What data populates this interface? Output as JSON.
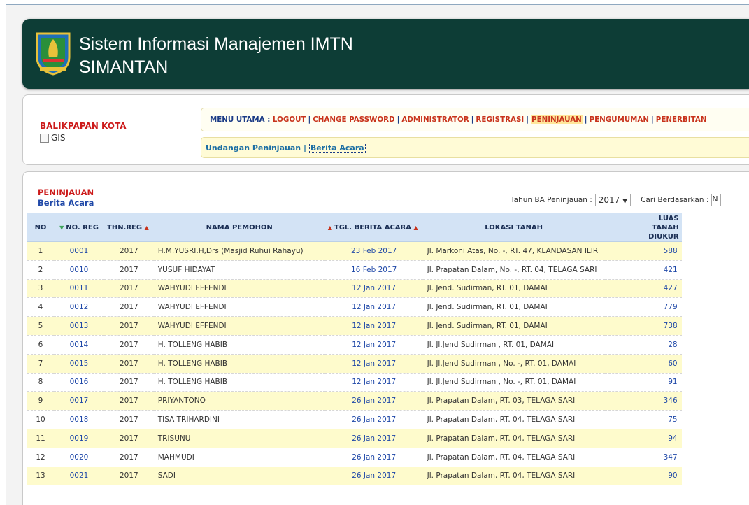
{
  "header": {
    "title": "Sistem Informasi Manajemen IMTN",
    "subtitle": "SIMANTAN"
  },
  "sidebar": {
    "city": "BALIKPAPAN KOTA",
    "gis_label": "GIS"
  },
  "menu": {
    "label": "MENU UTAMA :",
    "items": [
      "LOGOUT",
      "CHANGE PASSWORD",
      "ADMINISTRATOR",
      "REGISTRASI",
      "PENINJAUAN",
      "PENGUMUMAN",
      "PENERBITAN"
    ],
    "active": "PENINJAUAN"
  },
  "submenu": {
    "items": [
      "Undangan Peninjauan",
      "Berita Acara"
    ]
  },
  "section": {
    "title": "PENINJAUAN",
    "subtitle": "Berita Acara"
  },
  "filter": {
    "year_label": "Tahun BA Peninjauan :",
    "year_value": "2017",
    "search_label": "Cari Berdasarkan :",
    "search_value": "N"
  },
  "table": {
    "headers": [
      "NO",
      "NO. REG",
      "THN.REG",
      "NAMA PEMOHON",
      "TGL. BERITA ACARA",
      "LOKASI TANAH",
      "LUAS TANAH DIUKUR"
    ],
    "rows": [
      {
        "no": "1",
        "reg": "0001",
        "thn": "2017",
        "nama": "H.M.YUSRI.H,Drs (Masjid Ruhui Rahayu)",
        "tgl": "23 Feb 2017",
        "lokasi": "Jl. Markoni Atas, No. -, RT. 47, KLANDASAN ILIR",
        "luas": "588"
      },
      {
        "no": "2",
        "reg": "0010",
        "thn": "2017",
        "nama": "YUSUF HIDAYAT",
        "tgl": "16 Feb 2017",
        "lokasi": "Jl. Prapatan Dalam, No. -, RT. 04, TELAGA SARI",
        "luas": "421"
      },
      {
        "no": "3",
        "reg": "0011",
        "thn": "2017",
        "nama": "WAHYUDI EFFENDI",
        "tgl": "12 Jan 2017",
        "lokasi": "Jl. Jend. Sudirman, RT. 01, DAMAI",
        "luas": "427"
      },
      {
        "no": "4",
        "reg": "0012",
        "thn": "2017",
        "nama": "WAHYUDI EFFENDI",
        "tgl": "12 Jan 2017",
        "lokasi": "Jl. Jend. Sudirman, RT. 01, DAMAI",
        "luas": "779"
      },
      {
        "no": "5",
        "reg": "0013",
        "thn": "2017",
        "nama": "WAHYUDI EFFENDI",
        "tgl": "12 Jan 2017",
        "lokasi": "Jl. Jend. Sudirman, RT. 01, DAMAI",
        "luas": "738"
      },
      {
        "no": "6",
        "reg": "0014",
        "thn": "2017",
        "nama": "H. TOLLENG HABIB",
        "tgl": "12 Jan 2017",
        "lokasi": "Jl. Jl.Jend Sudirman , RT. 01, DAMAI",
        "luas": "28"
      },
      {
        "no": "7",
        "reg": "0015",
        "thn": "2017",
        "nama": "H. TOLLENG HABIB",
        "tgl": "12 Jan 2017",
        "lokasi": "Jl. Jl.Jend Sudirman , No. -, RT. 01, DAMAI",
        "luas": "60"
      },
      {
        "no": "8",
        "reg": "0016",
        "thn": "2017",
        "nama": "H. TOLLENG HABIB",
        "tgl": "12 Jan 2017",
        "lokasi": "Jl. Jl.Jend Sudirman , No. -, RT. 01, DAMAI",
        "luas": "91"
      },
      {
        "no": "9",
        "reg": "0017",
        "thn": "2017",
        "nama": "PRIYANTONO",
        "tgl": "26 Jan 2017",
        "lokasi": "Jl. Prapatan Dalam, RT. 03, TELAGA SARI",
        "luas": "346"
      },
      {
        "no": "10",
        "reg": "0018",
        "thn": "2017",
        "nama": "TISA TRIHARDINI",
        "tgl": "26 Jan 2017",
        "lokasi": "Jl. Prapatan Dalam, RT. 04, TELAGA SARI",
        "luas": "75"
      },
      {
        "no": "11",
        "reg": "0019",
        "thn": "2017",
        "nama": "TRISUNU",
        "tgl": "26 Jan 2017",
        "lokasi": "Jl. Prapatan Dalam, RT. 04, TELAGA SARI",
        "luas": "94"
      },
      {
        "no": "12",
        "reg": "0020",
        "thn": "2017",
        "nama": "MAHMUDI",
        "tgl": "26 Jan 2017",
        "lokasi": "Jl. Prapatan Dalam, RT. 04, TELAGA SARI",
        "luas": "347"
      },
      {
        "no": "13",
        "reg": "0021",
        "thn": "2017",
        "nama": "SADI",
        "tgl": "26 Jan 2017",
        "lokasi": "Jl. Prapatan Dalam, RT. 04, TELAGA SARI",
        "luas": "90"
      }
    ]
  }
}
